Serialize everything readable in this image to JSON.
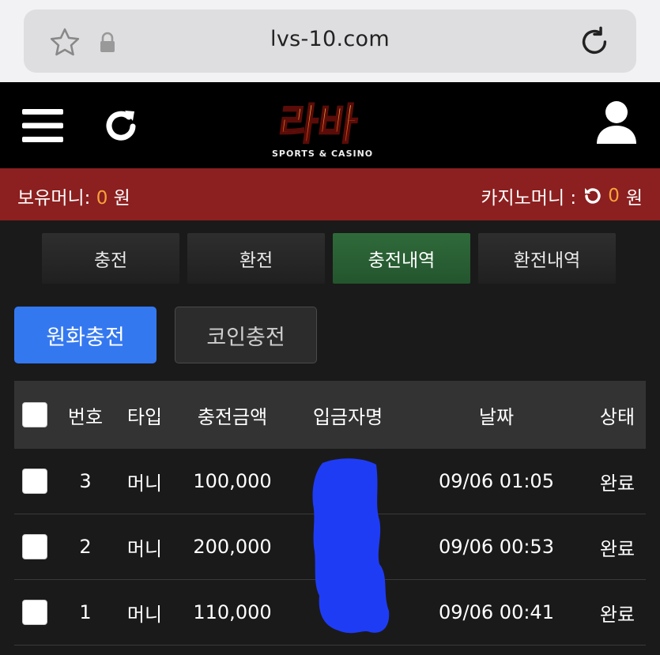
{
  "browser": {
    "url": "lvs-10.com",
    "icons": [
      "star-icon",
      "lock-icon",
      "reload-icon"
    ]
  },
  "header": {
    "logo_text_main": "라바",
    "logo_text_sub": "SPORTS & CASINO",
    "icons": [
      "menu-icon",
      "refresh-icon",
      "user-icon"
    ]
  },
  "balance": {
    "money_label": "보유머니:",
    "money_value": "0",
    "money_unit": "원",
    "casino_label": "카지노머니 :",
    "casino_value": "0",
    "casino_unit": "원"
  },
  "tabs": [
    {
      "label": "충전",
      "active": false
    },
    {
      "label": "환전",
      "active": false
    },
    {
      "label": "충전내역",
      "active": true
    },
    {
      "label": "환전내역",
      "active": false
    }
  ],
  "sub_buttons": {
    "won_label": "원화충전",
    "coin_label": "코인충전"
  },
  "table": {
    "headers": {
      "num": "번호",
      "type": "타입",
      "amount": "충전금액",
      "depositor": "입금자명",
      "date": "날짜",
      "status": "상태"
    },
    "rows": [
      {
        "num": "3",
        "type": "머니",
        "amount": "100,000",
        "date": "09/06 01:05",
        "status": "완료"
      },
      {
        "num": "2",
        "type": "머니",
        "amount": "200,000",
        "date": "09/06 00:53",
        "status": "완료"
      },
      {
        "num": "1",
        "type": "머니",
        "amount": "110,000",
        "date": "09/06 00:41",
        "status": "완료"
      }
    ]
  },
  "colors": {
    "accent_blue": "#3478f0",
    "balance_red": "#8c1f1f",
    "active_tab_green": "#2f6a3a",
    "amount_orange": "#f7a33b",
    "redaction_blue": "#1f3cf5"
  }
}
